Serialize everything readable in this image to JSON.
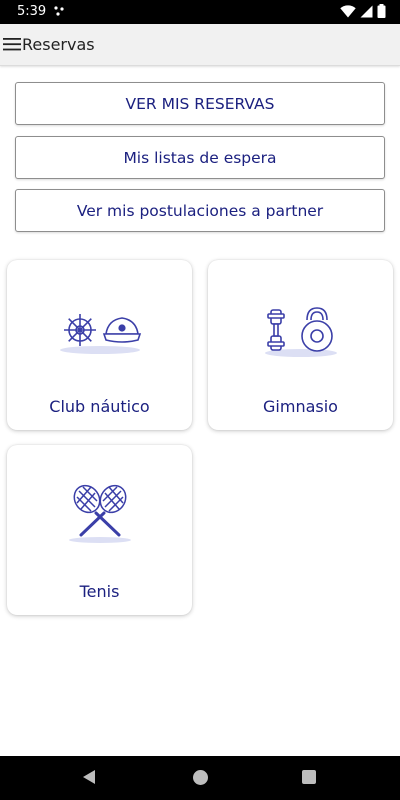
{
  "status_bar": {
    "time": "5:39"
  },
  "app_bar": {
    "title": "Reservas"
  },
  "buttons": {
    "ver_reservas": "VER MIS RESERVAS",
    "listas_espera": "Mis listas de espera",
    "postulaciones": "Ver mis postulaciones a partner"
  },
  "cards": [
    {
      "label": "Club náutico",
      "icon": "helm-captain-hat-icon"
    },
    {
      "label": "Gimnasio",
      "icon": "dumbbell-kettlebell-icon"
    },
    {
      "label": "Tenis",
      "icon": "tennis-rackets-icon"
    }
  ],
  "colors": {
    "accent": "#1c2180",
    "icon_blue": "#3b3fa8",
    "status_bg": "#000000"
  }
}
